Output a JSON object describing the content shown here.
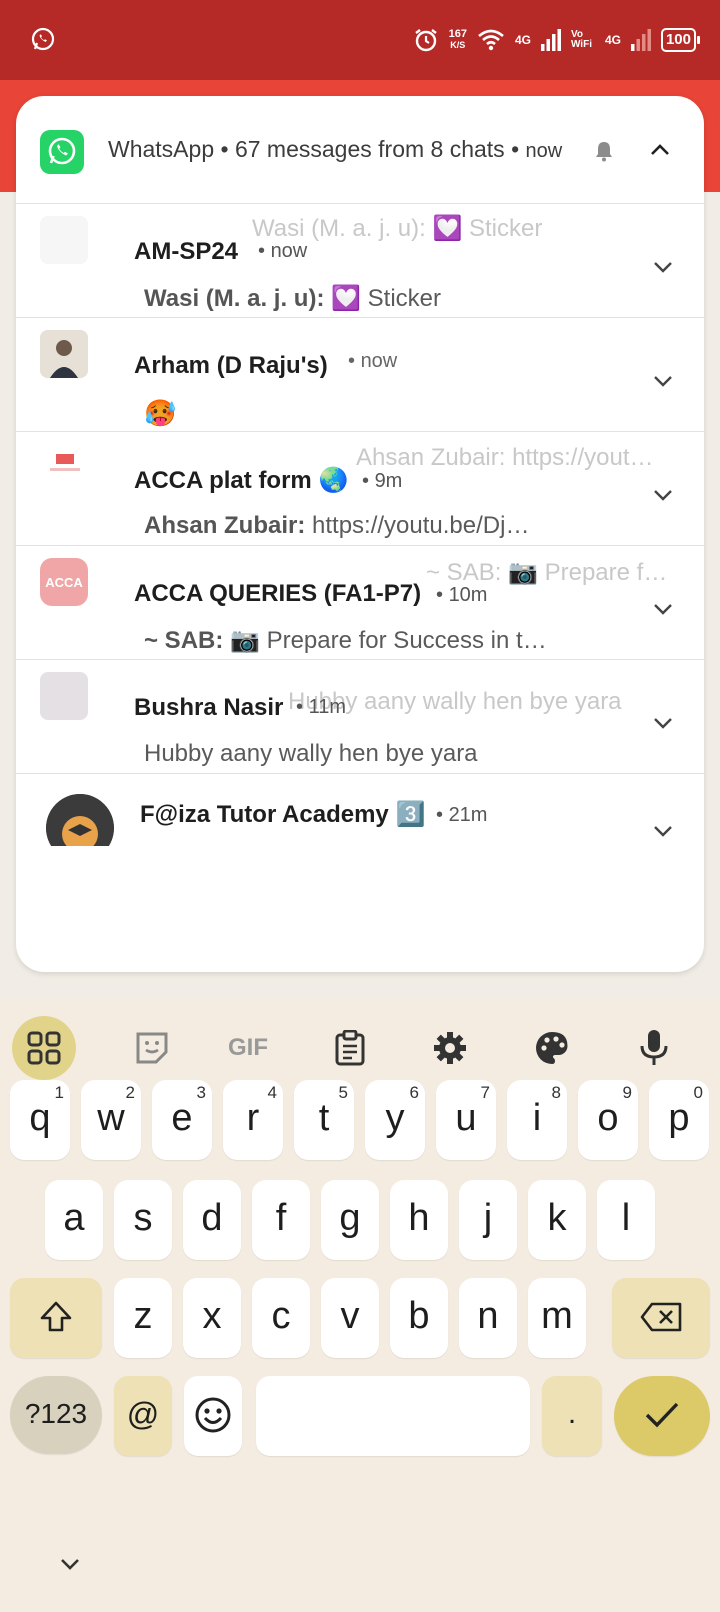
{
  "status_bar": {
    "net_speed": "167",
    "net_speed_unit": "K/S",
    "network_4g_1": "4G",
    "vowifi": "Vo WiFi",
    "network_4g_2": "4G",
    "battery": "100"
  },
  "notification": {
    "app_name": "WhatsApp",
    "summary": "67 messages from 8 chats",
    "time": "now",
    "rows": [
      {
        "title": "AM-SP24",
        "time": "now",
        "sender": "Wasi (M. a. j. u):",
        "message": "💟 Sticker",
        "ghost": "Wasi (M. a. j. u): 💟 Sticker"
      },
      {
        "title": "Arham (D Raju's)",
        "time": "now",
        "sender": "",
        "message": "🥵",
        "ghost": ""
      },
      {
        "title": "ACCA plat form 🌏",
        "time": "9m",
        "sender": "Ahsan Zubair:",
        "message": "https://youtu.be/Dj…",
        "ghost": "Ahsan Zubair: https://yout…"
      },
      {
        "title": "ACCA QUERIES (FA1-P7)",
        "time": "10m",
        "sender": "~ SAB:",
        "message": "📷 Prepare for Success in t…",
        "ghost": "~ SAB: 📷 Prepare f…"
      },
      {
        "title": "Bushra Nasir",
        "time": "11m",
        "sender": "",
        "message": "Hubby aany wally hen bye yara",
        "ghost": "Hubby aany wally hen bye yara"
      },
      {
        "title": "F@iza Tutor Academy 3️⃣",
        "time": "21m",
        "sender": "",
        "message": "",
        "ghost": ""
      }
    ],
    "acca_logo_text": "ACCA"
  },
  "keyboard": {
    "toolbar": [
      "apps",
      "sticker",
      "GIF",
      "clipboard",
      "settings",
      "theme",
      "voice"
    ],
    "row1": [
      {
        "k": "q",
        "n": "1"
      },
      {
        "k": "w",
        "n": "2"
      },
      {
        "k": "e",
        "n": "3"
      },
      {
        "k": "r",
        "n": "4"
      },
      {
        "k": "t",
        "n": "5"
      },
      {
        "k": "y",
        "n": "6"
      },
      {
        "k": "u",
        "n": "7"
      },
      {
        "k": "i",
        "n": "8"
      },
      {
        "k": "o",
        "n": "9"
      },
      {
        "k": "p",
        "n": "0"
      }
    ],
    "row2": [
      "a",
      "s",
      "d",
      "f",
      "g",
      "h",
      "j",
      "k",
      "l"
    ],
    "row3": [
      "z",
      "x",
      "c",
      "v",
      "b",
      "n",
      "m"
    ],
    "symbols_label": "?123",
    "at_label": "@",
    "period_label": "."
  }
}
